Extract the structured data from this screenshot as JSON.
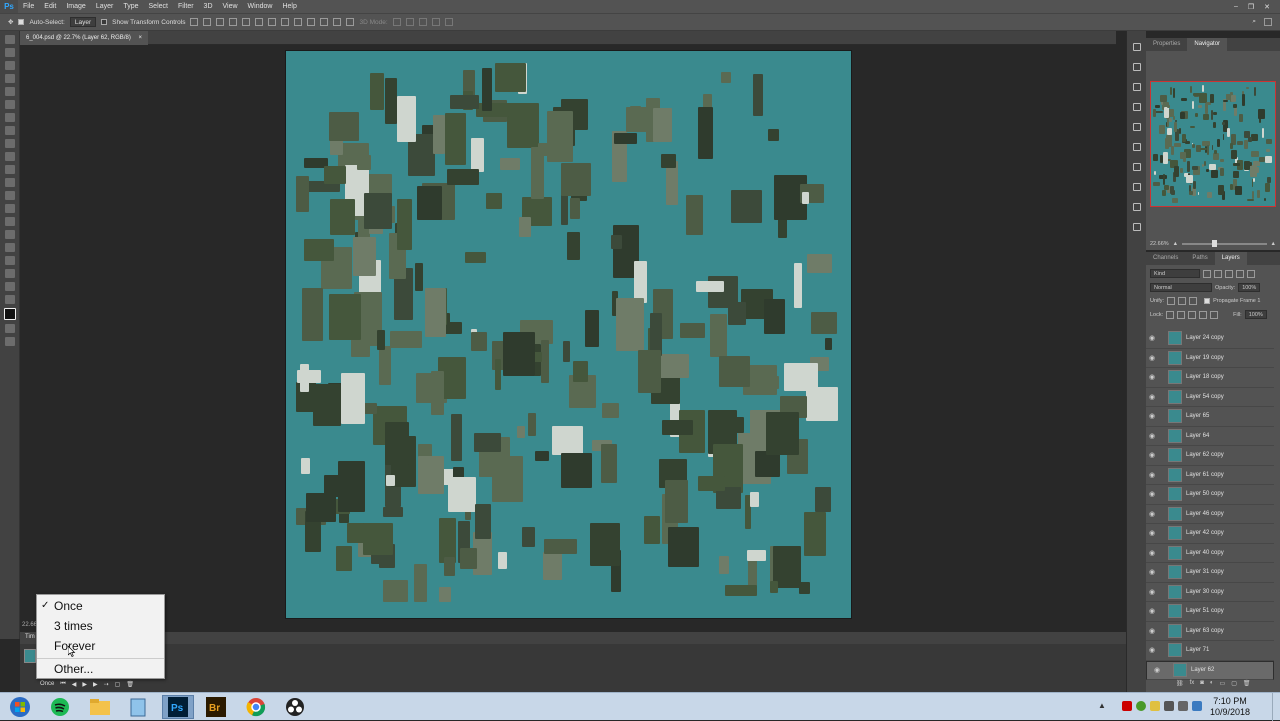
{
  "app": {
    "logo": "Ps",
    "menu": [
      "File",
      "Edit",
      "Image",
      "Layer",
      "Type",
      "Select",
      "Filter",
      "3D",
      "View",
      "Window",
      "Help"
    ]
  },
  "options": {
    "auto_select_label": "Auto-Select:",
    "auto_select_value": "Layer",
    "show_transform_label": "Show Transform Controls",
    "mode_3d": "3D Mode:"
  },
  "document": {
    "tab_title": "6_004.psd @ 22.7% (Layer 62, RGB/8)",
    "zoom": "22.66%"
  },
  "navigator": {
    "tabs": [
      "Properties",
      "Navigator"
    ],
    "active": "Navigator",
    "zoom": "22.66%"
  },
  "layers": {
    "tabs": [
      "Channels",
      "Paths",
      "Layers"
    ],
    "active": "Layers",
    "kind": "Kind",
    "blend_mode": "Normal",
    "opacity_label": "Opacity:",
    "opacity": "100%",
    "unify_label": "Unify:",
    "propagate_label": "Propagate Frame 1",
    "lock_label": "Lock:",
    "fill_label": "Fill:",
    "fill": "100%",
    "items": [
      "Layer 24 copy",
      "Layer 19 copy",
      "Layer 18 copy",
      "Layer 54 copy",
      "Layer 65",
      "Layer 64",
      "Layer 62 copy",
      "Layer 61 copy",
      "Layer 50 copy",
      "Layer 46 copy",
      "Layer 42 copy",
      "Layer 40 copy",
      "Layer 31 copy",
      "Layer 30 copy",
      "Layer 51 copy",
      "Layer 63 copy",
      "Layer 71",
      "Layer 62"
    ],
    "selected_index": 17
  },
  "timeline": {
    "tab": "Tim",
    "loop_value": "Once"
  },
  "popup": {
    "items": [
      "Once",
      "3 times",
      "Forever",
      "Other..."
    ],
    "checked_index": 0
  },
  "taskbar": {
    "time": "7:10 PM",
    "date": "10/9/2018"
  },
  "colors": {
    "canvas_bg": "#3a8a8e",
    "ps_blue": "#31a8ff"
  }
}
